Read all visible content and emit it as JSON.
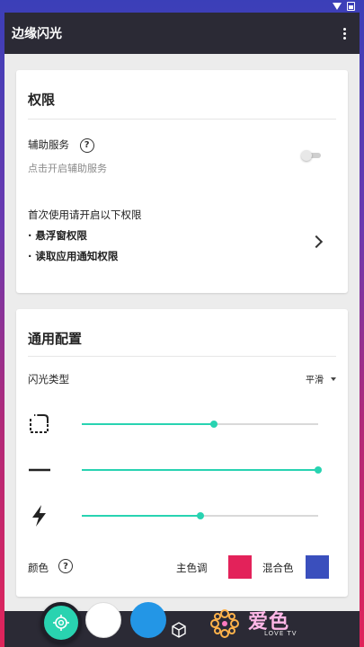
{
  "app": {
    "title": "边缘闪光"
  },
  "permissions": {
    "title": "权限",
    "accessibility_label": "辅助服务",
    "accessibility_hint": "点击开启辅助服务",
    "first_use_text": "首次使用请开启以下权限",
    "items": [
      "· 悬浮窗权限",
      "· 读取应用通知权限"
    ]
  },
  "general": {
    "title": "通用配置",
    "flash_type_label": "闪光类型",
    "flash_type_value": "平滑",
    "sliders": [
      {
        "icon": "rounded-corner-icon",
        "value": 0.56
      },
      {
        "icon": "stroke-width-icon",
        "value": 1.0
      },
      {
        "icon": "lightning-icon",
        "value": 0.5
      }
    ],
    "color_label": "颜色",
    "primary_label": "主色调",
    "mix_label": "混合色",
    "primary_color": "#e3225a",
    "mix_color": "#3a4fbd"
  },
  "watermark": {
    "brand": "爱色",
    "sub": "LOVE TV"
  },
  "colors": {
    "accent": "#28d3b1",
    "appbar": "#2b2a35"
  }
}
